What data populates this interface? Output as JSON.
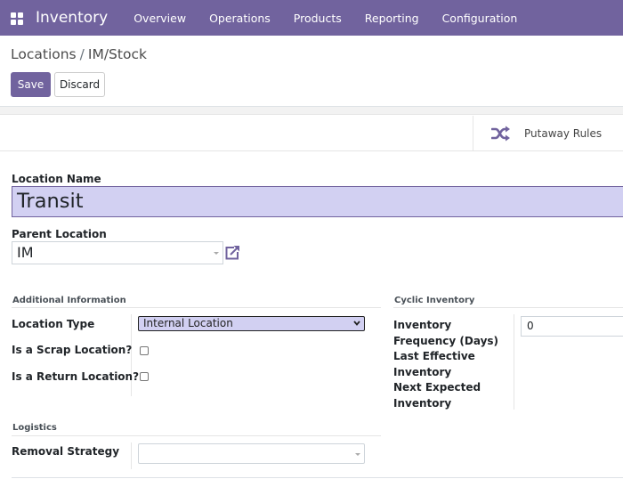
{
  "navbar": {
    "app_name": "Inventory",
    "menu": [
      "Overview",
      "Operations",
      "Products",
      "Reporting",
      "Configuration"
    ]
  },
  "breadcrumb": {
    "parent": "Locations",
    "separator": "/",
    "current": "IM/Stock"
  },
  "buttons": {
    "save": "Save",
    "discard": "Discard"
  },
  "smart_button": {
    "label": "Putaway Rules",
    "icon": "shuffle-icon"
  },
  "form": {
    "location_name_label": "Location Name",
    "location_name_value": "Transit",
    "parent_location_label": "Parent Location",
    "parent_location_value": "IM",
    "additional_info": {
      "title": "Additional Information",
      "location_type_label": "Location Type",
      "location_type_value": "Internal Location",
      "scrap_label": "Is a Scrap Location?",
      "scrap_checked": false,
      "return_label": "Is a Return Location?",
      "return_checked": false
    },
    "cyclic_inventory": {
      "title": "Cyclic Inventory",
      "frequency_label": "Inventory Frequency (Days)",
      "frequency_value": "0",
      "last_effective_label": "Last Effective Inventory",
      "next_expected_label": "Next Expected Inventory"
    },
    "logistics": {
      "title": "Logistics",
      "removal_strategy_label": "Removal Strategy",
      "removal_strategy_value": ""
    }
  },
  "colors": {
    "brand": "#71639e",
    "input_highlight": "#d2d0f2"
  }
}
